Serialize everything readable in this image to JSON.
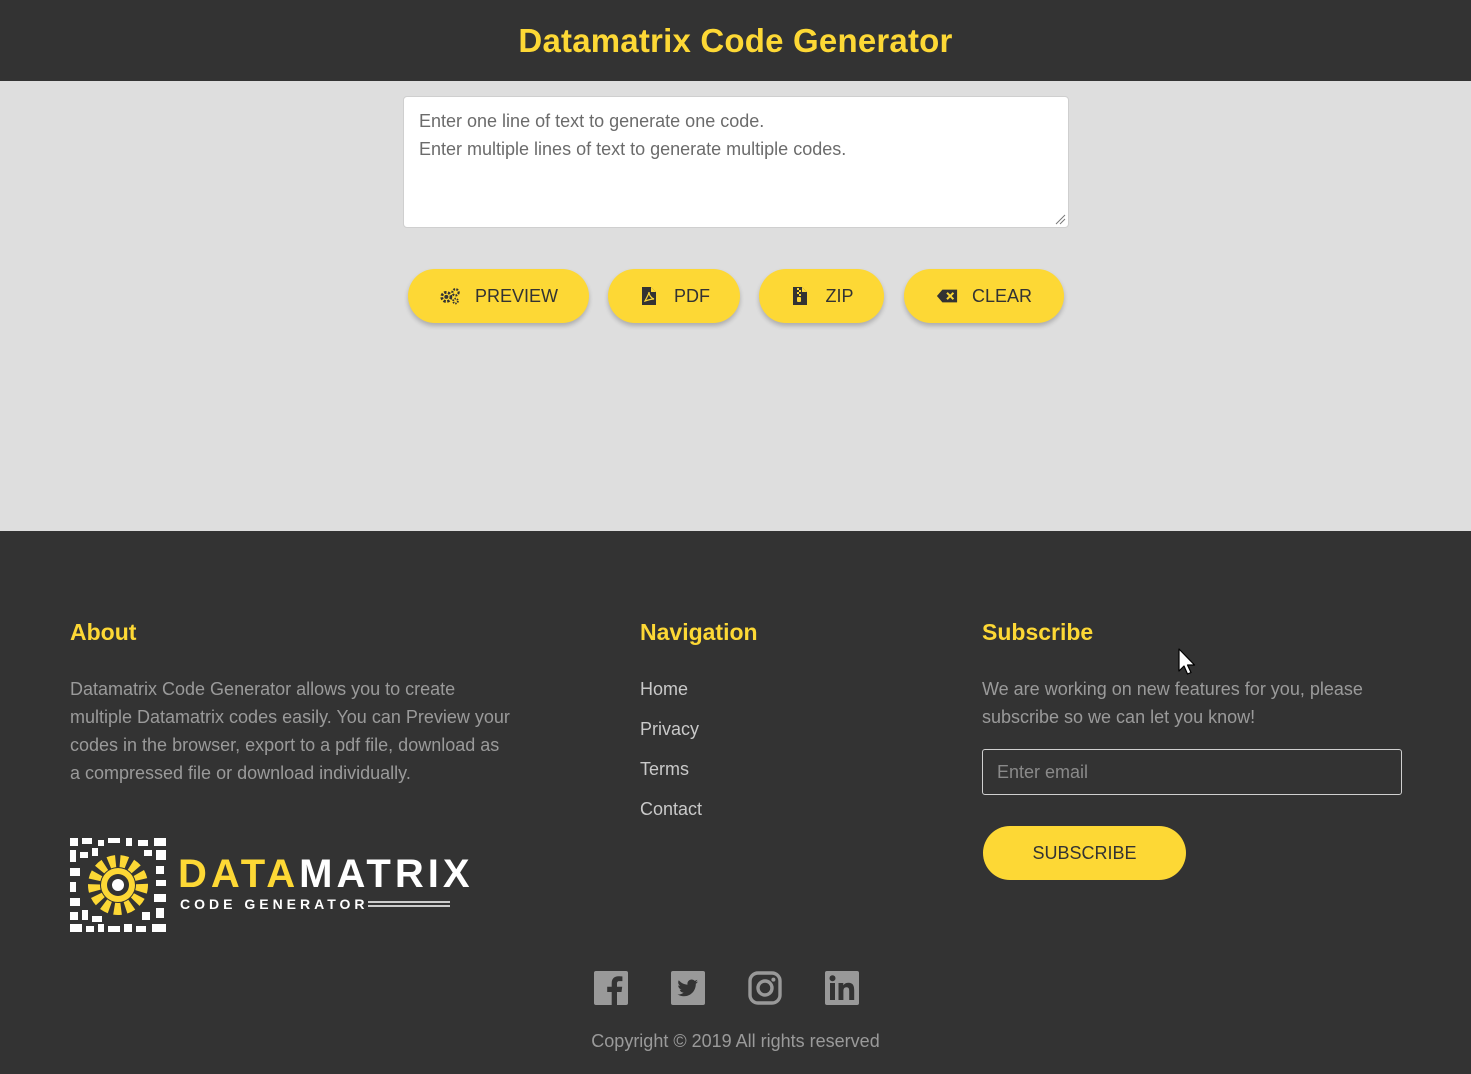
{
  "header": {
    "title": "Datamatrix Code Generator"
  },
  "editor": {
    "placeholder": "Enter one line of text to generate one code.\nEnter multiple lines of text to generate multiple codes.",
    "value": ""
  },
  "actions": {
    "preview": {
      "label": "PREVIEW",
      "icon": "gears-icon"
    },
    "pdf": {
      "label": "PDF",
      "icon": "file-pdf-icon"
    },
    "zip": {
      "label": "ZIP",
      "icon": "file-archive-icon"
    },
    "clear": {
      "label": "CLEAR",
      "icon": "backspace-icon"
    }
  },
  "footer": {
    "about": {
      "title": "About",
      "text": "Datamatrix Code Generator allows you to create multiple Datamatrix codes easily. You can Preview your codes in the browser, export to a pdf file, download as a compressed file or download individually."
    },
    "logo": {
      "word_accent": "DATA",
      "word_rest": "MATRIX",
      "subtitle": "CODE GENERATOR"
    },
    "navigation": {
      "title": "Navigation",
      "items": [
        {
          "label": "Home"
        },
        {
          "label": "Privacy"
        },
        {
          "label": "Terms"
        },
        {
          "label": "Contact"
        }
      ]
    },
    "subscribe": {
      "title": "Subscribe",
      "text": "We are working on new features for you, please subscribe so we can let you know!",
      "email_placeholder": "Enter email",
      "button_label": "SUBSCRIBE"
    },
    "social": [
      "facebook-icon",
      "twitter-icon",
      "instagram-icon",
      "linkedin-icon"
    ],
    "copyright": "Copyright © 2019 All rights reserved"
  },
  "colors": {
    "accent": "#fdd835",
    "dark": "#333333",
    "background": "#dedede"
  }
}
